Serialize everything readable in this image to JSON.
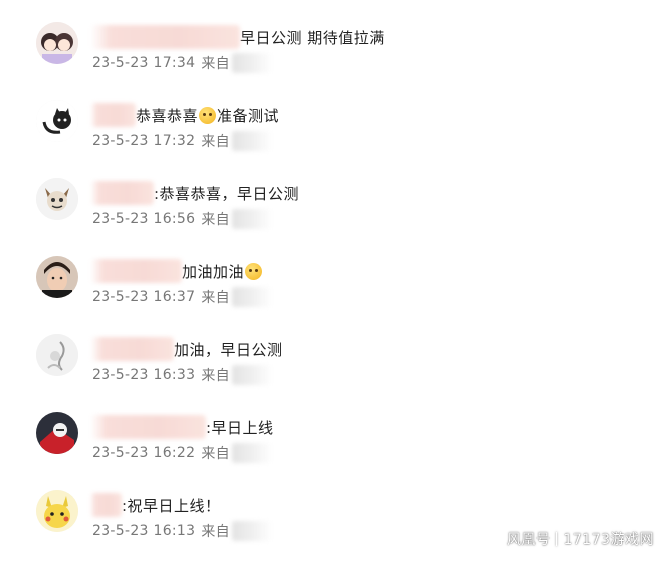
{
  "comments": [
    {
      "text": "早日公测 期待值拉满",
      "time": "23-5-23 17:34",
      "source_prefix": "来自"
    },
    {
      "text_before": "恭喜恭喜",
      "text_after": "准备测试",
      "emoji": "smiling-emoji",
      "time": "23-5-23 17:32",
      "source_prefix": "来自"
    },
    {
      "text": ":恭喜恭喜，早日公测",
      "time": "23-5-23 16:56",
      "source_prefix": "来自"
    },
    {
      "text": "加油加油",
      "emoji": "blushing-emoji",
      "time": "23-5-23 16:37",
      "source_prefix": "来自"
    },
    {
      "text": "加油，早日公测",
      "time": "23-5-23 16:33",
      "source_prefix": "来自"
    },
    {
      "text": ":早日上线",
      "time": "23-5-23 16:22",
      "source_prefix": "来自"
    },
    {
      "text": ":祝早日上线！",
      "time": "23-5-23 16:13",
      "source_prefix": "来自"
    }
  ],
  "watermark": {
    "left": "风凰号",
    "right": "17173游戏网"
  },
  "colors": {
    "text": "#222222",
    "meta": "#777777",
    "blur_name": "#f6d4cf"
  }
}
